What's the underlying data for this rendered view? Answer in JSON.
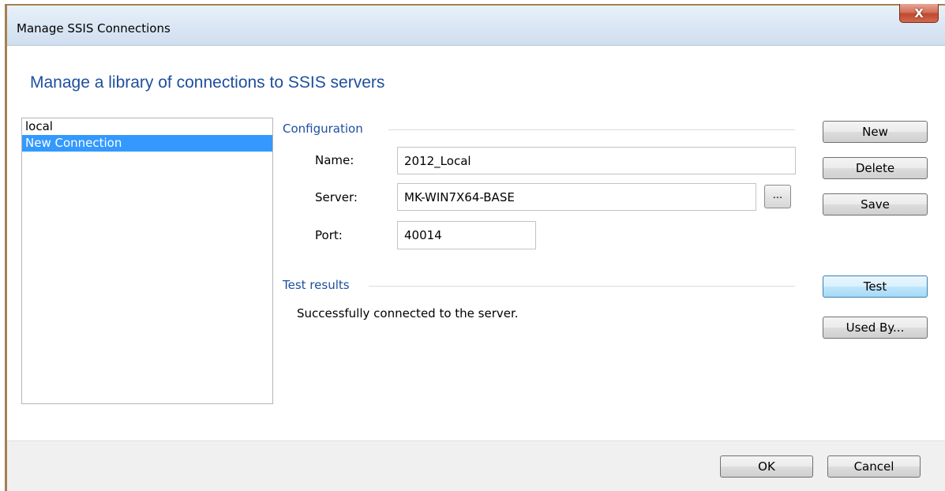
{
  "window": {
    "title": "Manage SSIS Connections",
    "close_label": "X"
  },
  "heading": "Manage a library of connections to SSIS servers",
  "connections": [
    {
      "label": "local",
      "selected": false
    },
    {
      "label": "New Connection",
      "selected": true
    }
  ],
  "configuration": {
    "group_label": "Configuration",
    "name_label": "Name:",
    "name_value": "2012_Local",
    "server_label": "Server:",
    "server_value": "MK-WIN7X64-BASE",
    "browse_label": "...",
    "port_label": "Port:",
    "port_value": "40014"
  },
  "test_results": {
    "group_label": "Test results",
    "message": "Successfully connected to the server."
  },
  "side_buttons": {
    "new": "New",
    "delete": "Delete",
    "save": "Save",
    "test": "Test",
    "used_by": "Used By..."
  },
  "footer_buttons": {
    "ok": "OK",
    "cancel": "Cancel"
  },
  "colors": {
    "accent_text": "#1e4fa0",
    "selection": "#3399ff",
    "close_button": "#c0492f"
  }
}
